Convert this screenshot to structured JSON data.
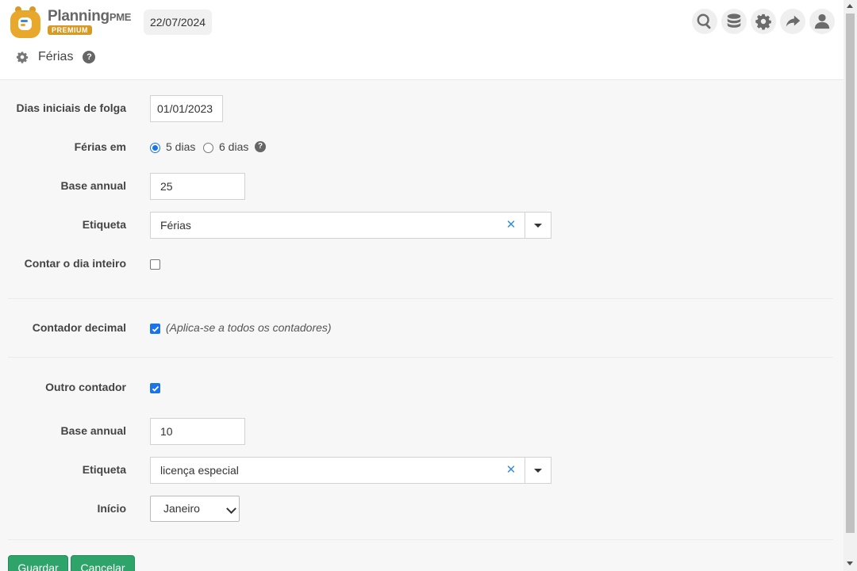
{
  "header": {
    "logo_text": "Planning",
    "logo_text_pme": "PME",
    "logo_badge": "PREMIUM",
    "date": "22/07/2024",
    "icons": [
      "search-icon",
      "database-icon",
      "gear-icon",
      "share-icon",
      "user-icon"
    ]
  },
  "page": {
    "title": "Férias",
    "help": "?"
  },
  "form": {
    "start_days_label": "Dias iniciais de folga",
    "start_days_value": "01/01/2023",
    "vacation_label": "Férias em",
    "opt_5": "5 dias",
    "opt_6": "6 dias",
    "opt_selected": "5 dias",
    "base_label": "Base annual",
    "base_value": "25",
    "tag_label": "Etiqueta",
    "tag_value": "Férias",
    "whole_day_label": "Contar o dia inteiro",
    "whole_day_checked": false,
    "decimal_label": "Contador decimal",
    "decimal_checked": true,
    "decimal_hint": "(Aplica-se a todos os contadores)",
    "other_label": "Outro contador",
    "other_checked": true,
    "base2_label": "Base annual",
    "base2_value": "10",
    "tag2_label": "Etiqueta",
    "tag2_value": "licença especial",
    "start_label": "Início",
    "start_value": "Janeiro"
  },
  "actions": {
    "save": "Guardar",
    "cancel": "Cancelar"
  },
  "colors": {
    "accent": "#1a73e8",
    "button": "#2ea36a",
    "logo": "#d79b25"
  }
}
